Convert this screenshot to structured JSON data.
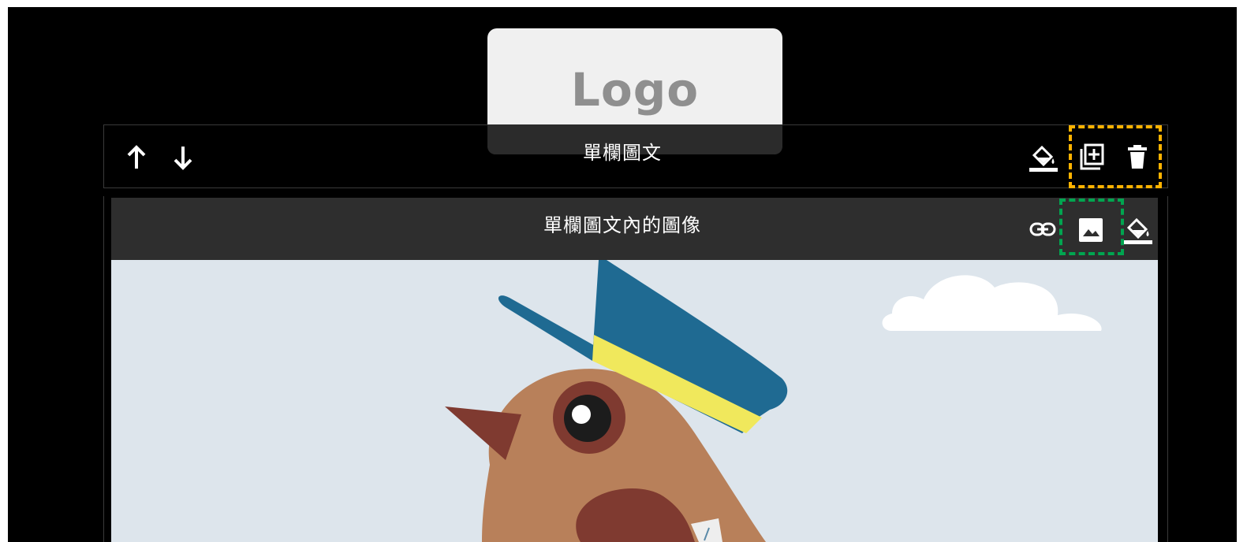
{
  "logo": {
    "text": "Logo"
  },
  "block": {
    "title": "單欄圖文",
    "move_up_icon": "arrow-up-icon",
    "move_down_icon": "arrow-down-icon",
    "fill_icon": "paint-bucket-icon",
    "duplicate_icon": "duplicate-icon",
    "delete_icon": "trash-icon"
  },
  "image_block": {
    "title": "單欄圖文內的圖像",
    "link_icon": "link-icon",
    "image_icon": "image-icon",
    "fill_icon": "paint-bucket-icon"
  },
  "colors": {
    "canvas_bg": "#000000",
    "toolbar_bg": "#2e2e2e",
    "highlight_orange": "#ffb300",
    "highlight_green": "#00a550",
    "image_sky": "#dde5ec"
  }
}
